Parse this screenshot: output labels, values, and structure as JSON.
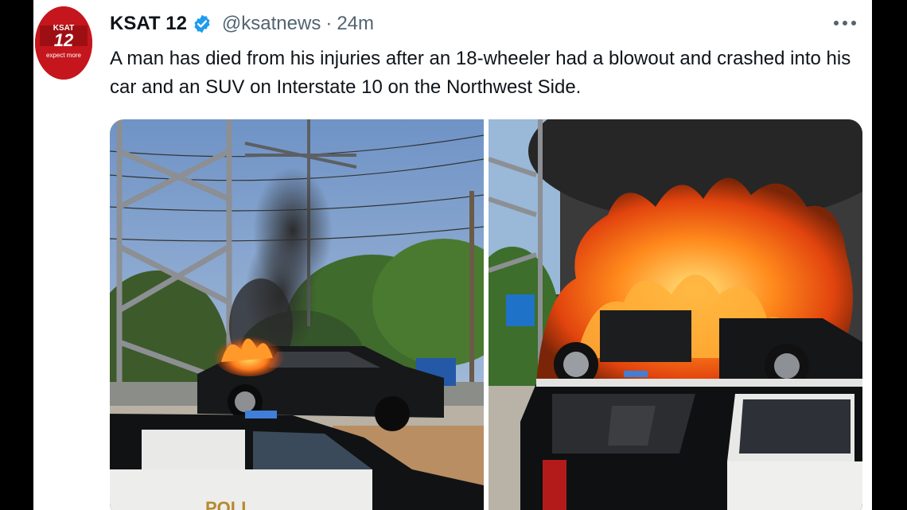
{
  "tweet": {
    "display_name": "KSAT 12",
    "handle": "@ksatnews",
    "separator": "·",
    "time": "24m",
    "text": "A man has died from his injuries after an 18-wheeler had a blowout and crashed into his car and an SUV on Interstate 10 on the Northwest Side."
  },
  "icons": {
    "verified": "verified-badge-icon",
    "more": "more-options-icon"
  },
  "colors": {
    "verified": "#1d9bf0",
    "brand_red": "#c5161d"
  }
}
